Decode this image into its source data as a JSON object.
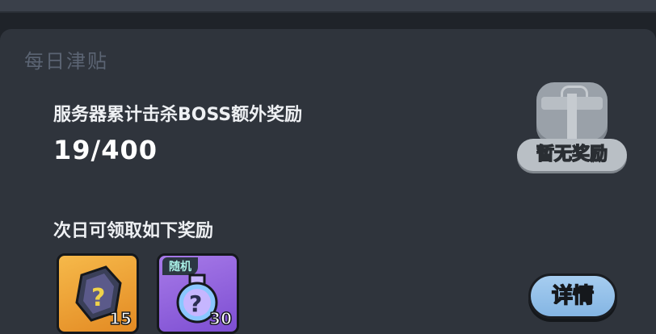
{
  "section": {
    "title": "每日津贴"
  },
  "kill_task": {
    "label": "服务器累计击杀BOSS额外奖励",
    "progress": "19/400"
  },
  "reward_status": {
    "label": "暂无奖励",
    "icon": "gift-box-icon"
  },
  "next_day": {
    "label": "次日可领取如下奖励"
  },
  "items": [
    {
      "icon": "gem-shard-icon",
      "count": "15",
      "tag": ""
    },
    {
      "icon": "potion-flask-icon",
      "count": "30",
      "tag": "随机"
    }
  ],
  "details_button": {
    "label": "详情"
  }
}
